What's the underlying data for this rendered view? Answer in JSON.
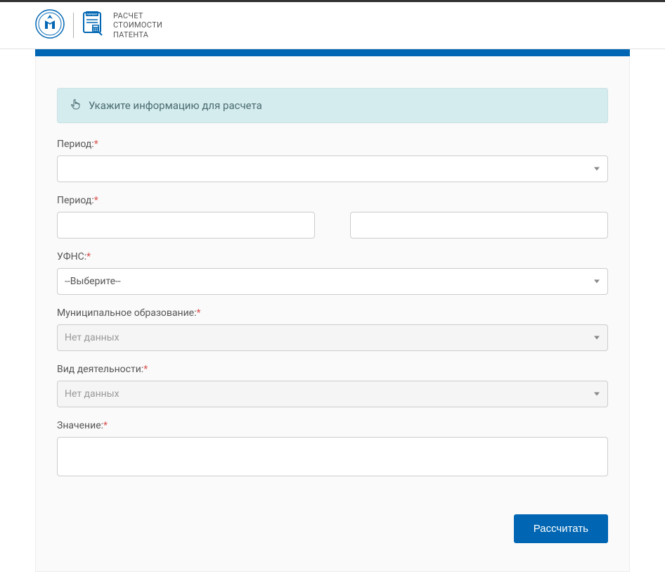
{
  "header": {
    "title_line1": "РАСЧЕТ",
    "title_line2": "СТОИМОСТИ",
    "title_line3": "ПАТЕНТА"
  },
  "banner": {
    "text": "Укажите информацию для расчета"
  },
  "form": {
    "period1": {
      "label": "Период:",
      "value": ""
    },
    "period2": {
      "label": "Период:",
      "value1": "",
      "value2": ""
    },
    "ufns": {
      "label": "УФНС:",
      "value": "--Выберите--"
    },
    "municipality": {
      "label": "Муниципальное образование:",
      "value": "Нет данных"
    },
    "activity": {
      "label": "Вид деятельности:",
      "value": "Нет данных"
    },
    "val": {
      "label": "Значение:",
      "value": ""
    }
  },
  "buttons": {
    "calculate": "Рассчитать"
  }
}
